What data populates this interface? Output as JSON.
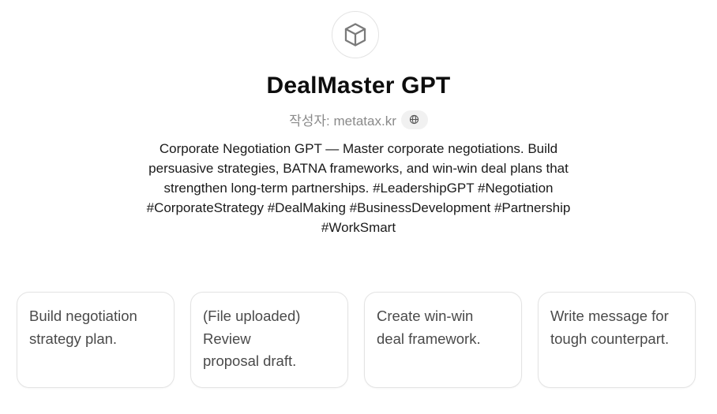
{
  "gpt": {
    "avatar_icon": "cube-icon",
    "name": "DealMaster GPT",
    "author_prefix": "작성자: ",
    "author_domain": "metatax.kr",
    "author_link_icon": "globe-icon",
    "description": "Corporate Negotiation GPT — Master corporate negotiations. Build persuasive strategies, BATNA frameworks, and win-win deal plans that strengthen long-term partnerships. #LeadershipGPT #Negotiation #CorporateStrategy #DealMaking #BusinessDevelopment #Partnership #WorkSmart"
  },
  "starters": [
    {
      "label": "Build negotiation\nstrategy plan."
    },
    {
      "label": "(File uploaded)\nReview\nproposal draft."
    },
    {
      "label": "Create win-win\ndeal framework."
    },
    {
      "label": "Write message for\ntough counterpart."
    }
  ],
  "colors": {
    "title": "#0d0d0d",
    "muted": "#8a8a8a",
    "card_border": "#e3e3e3",
    "card_text": "#4a4a4a"
  }
}
